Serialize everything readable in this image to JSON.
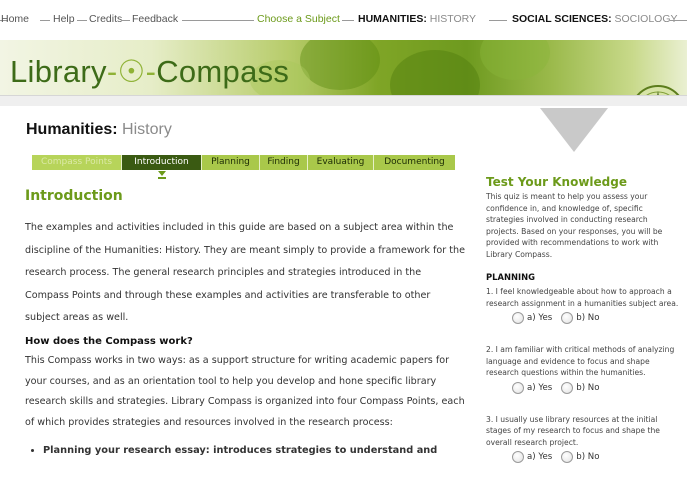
{
  "nav": {
    "home": "Home",
    "help": "Help",
    "credits": "Credits",
    "feedback": "Feedback",
    "choose_subject": "Choose a Subject",
    "humanities_label": "HUMANITIES:",
    "humanities_value": "HISTORY",
    "social_label": "SOCIAL SCIENCES:",
    "social_value": "SOCIOLOGY"
  },
  "banner": {
    "logo_part1": "Library",
    "logo_part2": "Compass"
  },
  "page": {
    "heading_bold": "Humanities:",
    "heading_sub": "History"
  },
  "tabs": [
    {
      "label": "Compass Points"
    },
    {
      "label": "Introduction"
    },
    {
      "label": "Planning"
    },
    {
      "label": "Finding"
    },
    {
      "label": "Evaluating"
    },
    {
      "label": "Documenting"
    }
  ],
  "main": {
    "title": "Introduction",
    "paragraph1": "The examples and activities included in this guide are based on a subject area within the discipline of the Humanities: History. They are meant simply to provide a framework for the research process. The general research principles and strategies introduced in the Compass Points and through these examples and activities are transferable to other subject areas as well.",
    "subheading": "How does the Compass work?",
    "paragraph2": "This Compass works in two ways: as a support structure for writing academic papers for your courses, and as an orientation tool to help you develop and hone specific library research skills and strategies. Library Compass is organized into four Compass Points, each of which provides strategies and resources involved in the research process:",
    "bullet1": "Planning your research essay: introduces strategies to understand and"
  },
  "quiz": {
    "title": "Test Your Knowledge",
    "intro": "This quiz is meant to help you assess your confidence in, and knowledge of, specific strategies involved in conducting research projects. Based on your responses, you will be provided with recommendations to work with Library Compass.",
    "section": "PLANNING",
    "questions": [
      {
        "text": "1. I feel knowledgeable about how to approach a research assignment in a humanities subject area.",
        "yes": "a) Yes",
        "no": "b) No"
      },
      {
        "text": "2. I am familiar with critical methods of analyzing language and evidence to focus and shape research questions within the humanities.",
        "yes": "a) Yes",
        "no": "b) No"
      },
      {
        "text": "3. I usually use library resources at the initial stages of my research to focus and shape the overall research project.",
        "yes": "a) Yes",
        "no": "b) No"
      }
    ]
  },
  "colors": {
    "accent_green": "#6c9a1a",
    "tab_bar": "#a9c84a",
    "tab_active": "#3a5a12"
  }
}
